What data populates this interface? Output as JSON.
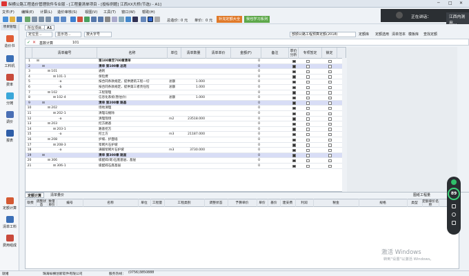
{
  "window": {
    "title": "纵横公路工程造价管理软件专业版 - [工程量清单项目 - [投标例题] 江西XX大桥(节选) - A1]"
  },
  "menu": [
    "文件(F)",
    "编辑(E)",
    "计算(L)",
    "造价审核(S)",
    "视图(V)",
    "工具(T)",
    "窗口(W)",
    "帮助(H)"
  ],
  "toolbar": {
    "price_label": "总造价：",
    "price_value": "0 元",
    "unit_label": "单价：",
    "unit_value": "0 元",
    "btn_shortcut": "补充定额大全",
    "btn_learn": "我也学习系列"
  },
  "meeting": {
    "text": "正在讲话：",
    "speaker": "江西内测用..."
  },
  "sidebar": [
    {
      "label": "造价书",
      "icon": "cost-book-icon"
    },
    {
      "label": "工料机",
      "icon": "materials-icon"
    },
    {
      "label": "费率",
      "icon": "rate-icon"
    },
    {
      "label": "分摊",
      "icon": "allocate-icon"
    },
    {
      "label": "调价",
      "icon": "adjust-price-icon"
    },
    {
      "label": "报表",
      "icon": "report-icon"
    }
  ],
  "bottom_sidebar": [
    {
      "label": "定额计算",
      "icon": "quota-calc-icon"
    },
    {
      "label": "清单工料",
      "icon": "bill-materials-icon"
    },
    {
      "label": "费用组成",
      "icon": "cost-composition-icon"
    }
  ],
  "project_tab": "项目管理",
  "doc_tabs": [
    "所在项目...",
    "A1"
  ],
  "filter": {
    "field1": "定位至...",
    "field2": "显示范...",
    "field3": "按大字号",
    "quota_select": "部颁公路工程预算定额(2018)"
  },
  "right_buttons": [
    "定额库",
    "定额选用",
    "清单范本",
    "模板库",
    "查找定额"
  ],
  "formula": {
    "label": "基数计算",
    "value": "101"
  },
  "grid_headers": [
    "清单编号",
    "名称",
    "单位",
    "清单数量",
    "清单单价",
    "金额(F)",
    "备注",
    "单价分析",
    "专项暂定",
    "锁定"
  ],
  "rows": [
    {
      "n": "1",
      "indent": 0,
      "code": "",
      "name": "第100章至700章清单",
      "unit": "",
      "qty": "",
      "amt": "0",
      "blue": false,
      "c1": true
    },
    {
      "n": "2",
      "indent": 1,
      "code": "",
      "name": "清单 第100章  总则",
      "unit": "",
      "qty": "",
      "amt": "0",
      "blue": true,
      "c1": true
    },
    {
      "n": "3",
      "indent": 2,
      "code": "101",
      "name": "通则",
      "unit": "",
      "qty": "",
      "amt": "0",
      "blue": false,
      "c1": true
    },
    {
      "n": "4",
      "indent": 3,
      "code": "101-1",
      "name": "保险费",
      "unit": "",
      "qty": "",
      "amt": "0",
      "blue": false,
      "c1": true
    },
    {
      "n": "5",
      "indent": 4,
      "code": "-a",
      "name": "按合同条款规定，提供建筑工程一切",
      "unit": "总额",
      "qty": "1.000",
      "amt": "0",
      "blue": false,
      "c1": true
    },
    {
      "n": "6",
      "indent": 4,
      "code": "-b",
      "name": "按合同条款规定，提供第三者责任险",
      "unit": "总额",
      "qty": "1.000",
      "amt": "0",
      "blue": false,
      "c1": true
    },
    {
      "n": "7",
      "indent": 2,
      "code": "102",
      "name": "工程管理",
      "unit": "",
      "qty": "",
      "amt": "0",
      "blue": false,
      "c1": true
    },
    {
      "n": "8",
      "indent": 3,
      "code": "102-4",
      "name": "信息化系统(暂估价)",
      "unit": "总额",
      "qty": "1.000",
      "amt": "0",
      "blue": false,
      "c1": true
    },
    {
      "n": "9",
      "indent": 1,
      "code": "",
      "name": "清单 第200章  路基",
      "unit": "",
      "qty": "",
      "amt": "0",
      "blue": true,
      "c1": true
    },
    {
      "n": "10",
      "indent": 2,
      "code": "202",
      "name": "场地清理",
      "unit": "",
      "qty": "",
      "amt": "0",
      "blue": false,
      "c1": true
    },
    {
      "n": "11",
      "indent": 3,
      "code": "202-1",
      "name": "清理与掘除",
      "unit": "",
      "qty": "",
      "amt": "0",
      "blue": false,
      "c1": true
    },
    {
      "n": "12",
      "indent": 4,
      "code": "-a",
      "name": "清理现场",
      "unit": "m2",
      "qty": "23518.000",
      "amt": "0",
      "blue": false,
      "c1": true
    },
    {
      "n": "13",
      "indent": 2,
      "code": "203",
      "name": "挖方路基",
      "unit": "",
      "qty": "",
      "amt": "0",
      "blue": false,
      "c1": true
    },
    {
      "n": "14",
      "indent": 3,
      "code": "203-1",
      "name": "路基挖方",
      "unit": "",
      "qty": "",
      "amt": "0",
      "blue": false,
      "c1": true
    },
    {
      "n": "15",
      "indent": 4,
      "code": "-a",
      "name": "挖土方",
      "unit": "m3",
      "qty": "21187.000",
      "amt": "0",
      "blue": false,
      "c1": true
    },
    {
      "n": "16",
      "indent": 2,
      "code": "208",
      "name": "护坡、护面墙",
      "unit": "",
      "qty": "",
      "amt": "0",
      "blue": false,
      "c1": true
    },
    {
      "n": "17",
      "indent": 3,
      "code": "208-3",
      "name": "浆砌片石护坡",
      "unit": "",
      "qty": "",
      "amt": "0",
      "blue": false,
      "c1": true
    },
    {
      "n": "18",
      "indent": 4,
      "code": "-a",
      "name": "满铺浆砌片石护坡",
      "unit": "m3",
      "qty": "3730.000",
      "amt": "0",
      "blue": false,
      "c1": true
    },
    {
      "n": "19",
      "indent": 1,
      "code": "",
      "name": "清单 第300章  路面",
      "unit": "",
      "qty": "",
      "amt": "0",
      "blue": true,
      "c1": true
    },
    {
      "n": "20",
      "indent": 2,
      "code": "306",
      "name": "级配碎(砾)石底基层、基层",
      "unit": "",
      "qty": "",
      "amt": "0",
      "blue": false,
      "c1": true
    },
    {
      "n": "21",
      "indent": 3,
      "code": "306-1",
      "name": "级配碎石底基层",
      "unit": "",
      "qty": "",
      "amt": "0",
      "blue": false,
      "c1": true
    }
  ],
  "bottom_tabs": [
    "定额计算",
    "清单量价"
  ],
  "bottom_right_btn": "图纸工程量",
  "bottom_headers": [
    "取费",
    "调整状态",
    "数量单价",
    "编号",
    "名称",
    "单位",
    "工程量",
    "工程类别",
    "调整状态",
    "予算单价",
    "单价",
    "基价",
    "建安费",
    "利润",
    "税金",
    "规格",
    "类型",
    "定额单价名称"
  ],
  "status": {
    "left": "就绪",
    "company": "珠海纵横创新软件有限公司",
    "phone": "(0756)3850888",
    "service": "服务热线："
  },
  "watermark": {
    "line1": "激活 Windows",
    "line2": "转到\"设置\"以激活 Windows。"
  },
  "widget": {
    "score": "89"
  }
}
